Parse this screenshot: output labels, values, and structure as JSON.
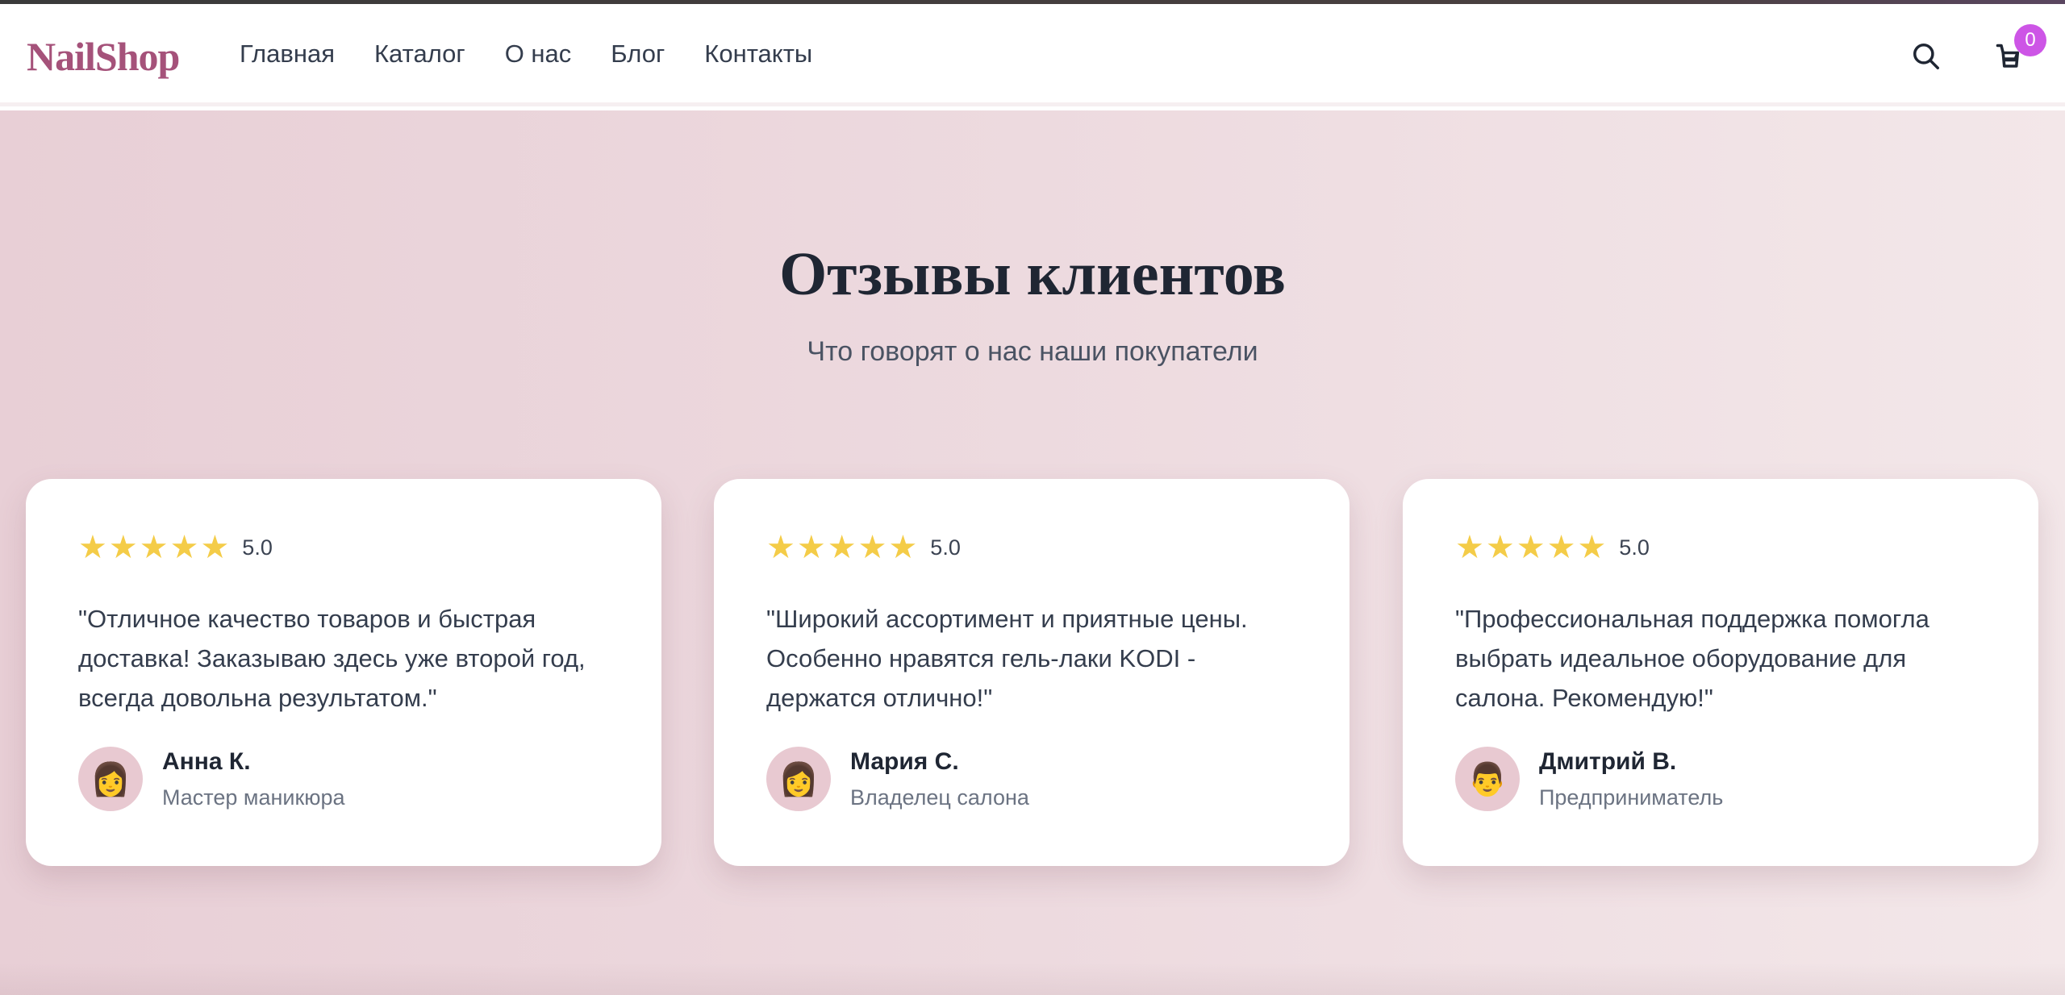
{
  "header": {
    "logo": "NailShop",
    "nav": [
      "Главная",
      "Каталог",
      "О нас",
      "Блог",
      "Контакты"
    ],
    "cart_count": "0",
    "icons": {
      "search": "search-icon",
      "cart": "cart-icon"
    }
  },
  "section": {
    "title": "Отзывы клиентов",
    "subtitle": "Что говорят о нас наши покупатели"
  },
  "reviews": [
    {
      "stars": 5,
      "score": "5.0",
      "text": "\"Отличное качество товаров и быстрая доставка! Заказываю здесь уже второй год, всегда довольна результатом.\"",
      "avatar": "👩",
      "name": "Анна К.",
      "role": "Мастер маникюра"
    },
    {
      "stars": 5,
      "score": "5.0",
      "text": "\"Широкий ассортимент и приятные цены. Особенно нравятся гель-лаки KODI - держатся отлично!\"",
      "avatar": "👩",
      "name": "Мария С.",
      "role": "Владелец салона"
    },
    {
      "stars": 5,
      "score": "5.0",
      "text": "\"Профессиональная поддержка помогла выбрать идеальное оборудование для салона. Рекомендую!\"",
      "avatar": "👨",
      "name": "Дмитрий В.",
      "role": "Предприниматель"
    }
  ],
  "colors": {
    "brand": "#a5527a",
    "star": "#f4cc48",
    "badge": "#cd55e6"
  }
}
